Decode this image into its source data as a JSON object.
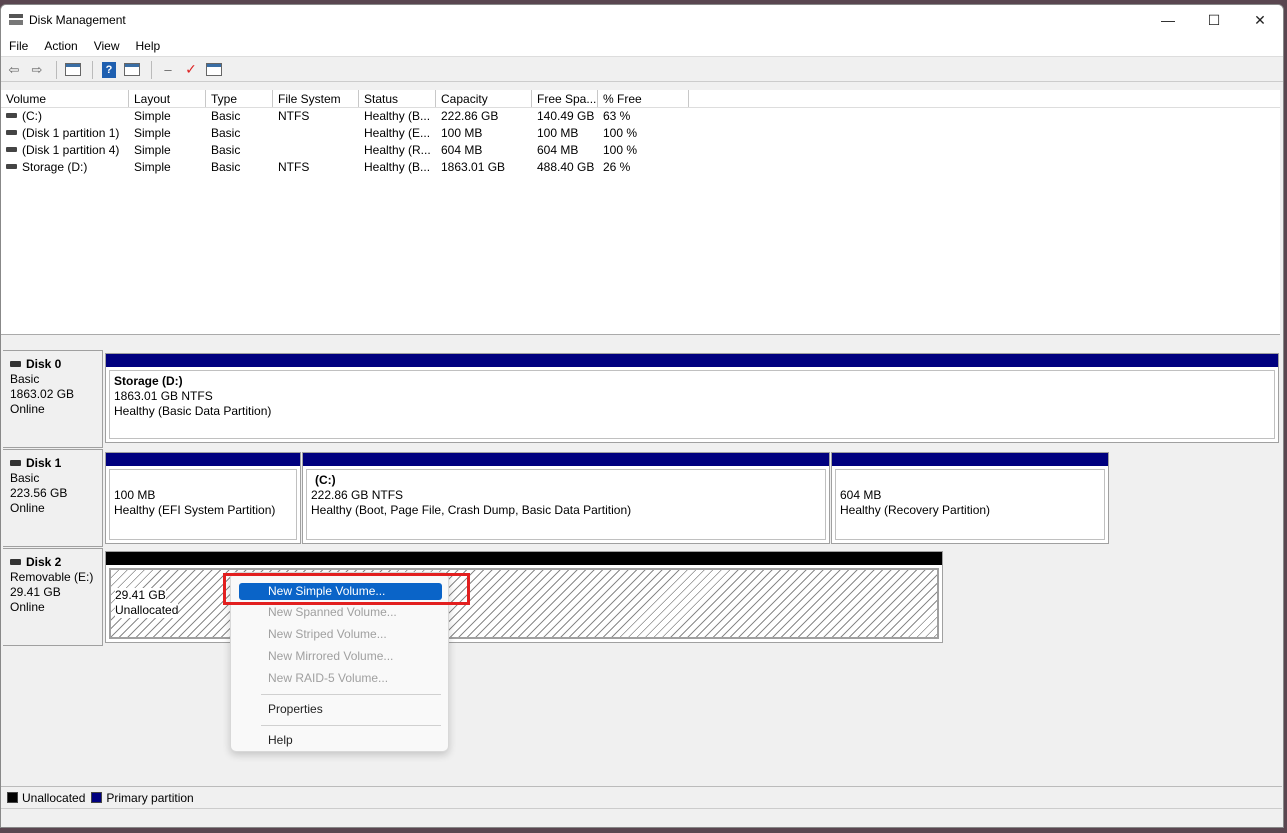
{
  "window": {
    "title": "Disk Management",
    "controls": [
      "—",
      "☐",
      "✕"
    ]
  },
  "menu": [
    "File",
    "Action",
    "View",
    "Help"
  ],
  "table": {
    "headers": [
      "Volume",
      "Layout",
      "Type",
      "File System",
      "Status",
      "Capacity",
      "Free Spa...",
      "% Free",
      ""
    ],
    "rows": [
      [
        "(C:)",
        "Simple",
        "Basic",
        "NTFS",
        "Healthy (B...",
        "222.86 GB",
        "140.49 GB",
        "63 %"
      ],
      [
        "(Disk 1 partition 1)",
        "Simple",
        "Basic",
        "",
        "Healthy (E...",
        "100 MB",
        "100 MB",
        "100 %"
      ],
      [
        "(Disk 1 partition 4)",
        "Simple",
        "Basic",
        "",
        "Healthy (R...",
        "604 MB",
        "604 MB",
        "100 %"
      ],
      [
        "Storage (D:)",
        "Simple",
        "Basic",
        "NTFS",
        "Healthy (B...",
        "1863.01 GB",
        "488.40 GB",
        "26 %"
      ]
    ]
  },
  "disks": [
    {
      "name": "Disk 0",
      "type": "Basic",
      "size": "1863.02 GB",
      "state": "Online",
      "partitions": [
        {
          "title": "Storage  (D:)",
          "line1": "1863.01 GB NTFS",
          "line2": "Healthy (Basic Data Partition)"
        }
      ]
    },
    {
      "name": "Disk 1",
      "type": "Basic",
      "size": "223.56 GB",
      "state": "Online",
      "partitions": [
        {
          "title": "",
          "line1": "100 MB",
          "line2": "Healthy (EFI System Partition)"
        },
        {
          "title": "(C:)",
          "line1": "222.86 GB NTFS",
          "line2": "Healthy (Boot, Page File, Crash Dump, Basic Data Partition)"
        },
        {
          "title": "",
          "line1": "604 MB",
          "line2": "Healthy (Recovery Partition)"
        }
      ]
    },
    {
      "name": "Disk 2",
      "type": "Removable (E:)",
      "size": "29.41 GB",
      "state": "Online",
      "partitions": [
        {
          "title": "",
          "line1": "29.41 GB",
          "line2": "Unallocated"
        }
      ]
    }
  ],
  "context_menu": {
    "items": [
      {
        "label": "New Simple Volume...",
        "enabled": true,
        "selected": true
      },
      {
        "label": "New Spanned Volume...",
        "enabled": false
      },
      {
        "label": "New Striped Volume...",
        "enabled": false
      },
      {
        "label": "New Mirrored Volume...",
        "enabled": false
      },
      {
        "label": "New RAID-5 Volume...",
        "enabled": false
      },
      {
        "label": "Properties",
        "enabled": true
      },
      {
        "label": "Help",
        "enabled": true
      }
    ]
  },
  "legend": [
    {
      "label": "Unallocated",
      "color": "#000000"
    },
    {
      "label": "Primary partition",
      "color": "#00007f"
    }
  ],
  "colors": {
    "primary_partition": "#00007f",
    "unallocated": "#000000",
    "highlight": "#e21f1f",
    "menu_selected": "#0a64c8"
  }
}
